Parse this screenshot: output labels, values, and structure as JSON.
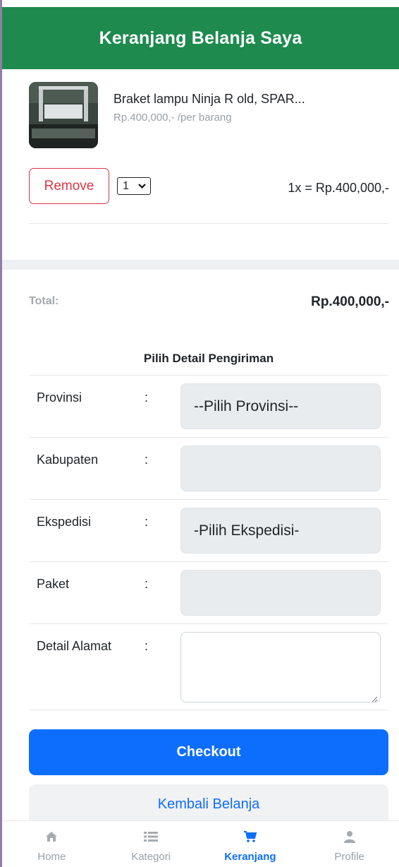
{
  "header": {
    "title": "Keranjang Belanja Saya"
  },
  "colors": {
    "header_bg": "#1e8a4e",
    "primary": "#0d6efd",
    "danger": "#dc3545",
    "muted": "#9aa0a6"
  },
  "cart": {
    "items": [
      {
        "name": "Braket lampu Ninja R old, SPAR...",
        "price": "Rp.400,000,- /per barang",
        "remove_label": "Remove",
        "quantity": "1",
        "subtotal": "1x = Rp.400,000,-"
      }
    ],
    "total_label": "Total:",
    "total_value": "Rp.400,000,-"
  },
  "shipping": {
    "title": "Pilih Detail Pengiriman",
    "fields": [
      {
        "label": "Provinsi",
        "colon": ":",
        "value": "--Pilih Provinsi--"
      },
      {
        "label": "Kabupaten",
        "colon": ":",
        "value": ""
      },
      {
        "label": "Ekspedisi",
        "colon": ":",
        "value": "-Pilih Ekspedisi-"
      },
      {
        "label": "Paket",
        "colon": ":",
        "value": ""
      },
      {
        "label": "Detail Alamat",
        "colon": ":",
        "value": ""
      }
    ]
  },
  "actions": {
    "checkout_label": "Checkout",
    "back_label": "Kembali Belanja"
  },
  "nav": {
    "items": [
      {
        "label": "Home",
        "icon": "home-icon",
        "active": false
      },
      {
        "label": "Kategori",
        "icon": "list-icon",
        "active": false
      },
      {
        "label": "Keranjang",
        "icon": "cart-icon",
        "active": true
      },
      {
        "label": "Profile",
        "icon": "user-icon",
        "active": false
      }
    ]
  }
}
